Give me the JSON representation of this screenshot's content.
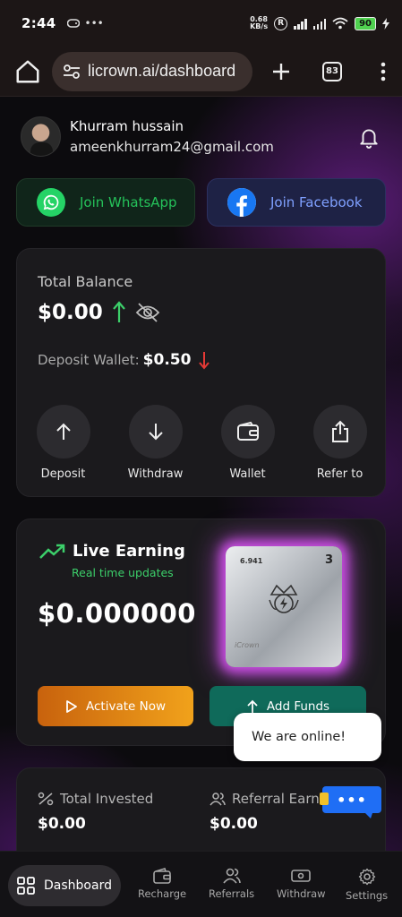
{
  "status_bar": {
    "time": "2:44",
    "net_speed_top": "0.68",
    "net_speed_unit": "KB/s",
    "r_badge": "R",
    "battery": "90"
  },
  "browser": {
    "url": "licrown.ai/dashboard",
    "tab_count": "83"
  },
  "profile": {
    "name": "Khurram hussain",
    "email": "ameenkhurram24@gmail.com"
  },
  "social": {
    "whatsapp_label": "Join WhatsApp",
    "facebook_label": "Join Facebook"
  },
  "balance": {
    "label": "Total Balance",
    "value": "$0.00",
    "deposit_label": "Deposit Wallet:",
    "deposit_value": "$0.50",
    "actions": [
      {
        "label": "Deposit",
        "icon": "arrow-up-icon"
      },
      {
        "label": "Withdraw",
        "icon": "arrow-down-icon"
      },
      {
        "label": "Wallet",
        "icon": "wallet-icon"
      },
      {
        "label": "Refer to",
        "icon": "share-icon"
      }
    ]
  },
  "live": {
    "title": "Live Earning",
    "subtitle": "Real time updates",
    "value": "$0.000000",
    "chip_serial": "6.941",
    "chip_number": "3",
    "chip_brand": "iCrown",
    "activate_label": "Activate Now",
    "add_funds_label": "Add Funds"
  },
  "stats": {
    "invested_label": "Total Invested",
    "invested_value": "$0.00",
    "referral_label": "Referral Earni",
    "referral_value": "$0.00"
  },
  "chat": {
    "popup_text": "We are online!",
    "bubble_text": "•••"
  },
  "nav": {
    "dashboard": "Dashboard",
    "recharge": "Recharge",
    "referrals": "Referrals",
    "withdraw": "Withdraw",
    "settings": "Settings"
  },
  "colors": {
    "green": "#3ccf6a",
    "red": "#e53935",
    "teal": "#0f6a5a",
    "orange": "#f1a21b",
    "purple_glow": "#c84ee0",
    "chat_blue": "#1f6ef5"
  }
}
